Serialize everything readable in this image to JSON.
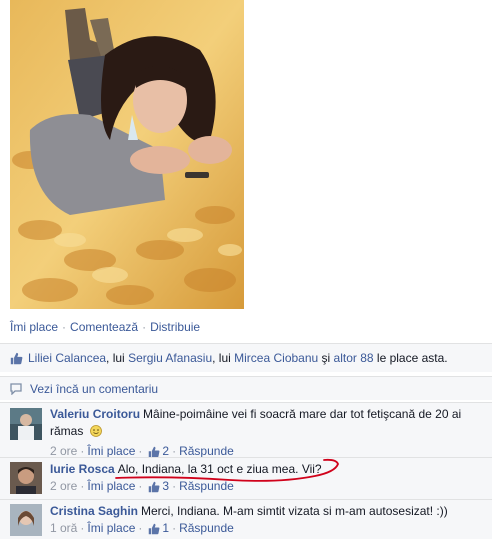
{
  "post_actions": {
    "like": "Îmi place",
    "comment": "Comentează",
    "share": "Distribuie",
    "separator": "·"
  },
  "likes": {
    "name1": "Liliei Calancea",
    "sep1": ", lui ",
    "name2": "Sergiu Afanasiu",
    "sep2": ", lui ",
    "name3": "Mircea Ciobanu",
    "sep3": " şi ",
    "others": "altor 88",
    "tail": " le place asta."
  },
  "more_comments": {
    "label": "Vezi încă un comentariu"
  },
  "comments": [
    {
      "author": "Valeriu Croitoru",
      "text": "Mâine-poimâine vei fi soacră mare dar tot fetişcană de 20 ai rămas",
      "emoji": "smile-emoji",
      "time": "2 ore",
      "like_label": "Îmi place",
      "like_count": "2",
      "reply_label": "Răspunde"
    },
    {
      "author": "Iurie Rosca",
      "text": "Alo, Indiana, la 31 oct e ziua mea. Vii?",
      "time": "2 ore",
      "like_label": "Îmi place",
      "like_count": "3",
      "reply_label": "Răspunde"
    },
    {
      "author": "Cristina Saghin",
      "text": "Merci, Indiana. M-am simtit vizata si m-am autosesizat! :))",
      "time": "1 oră",
      "like_label": "Îmi place",
      "like_count": "1",
      "reply_label": "Răspunde"
    }
  ],
  "colors": {
    "link": "#3b5998",
    "meta": "#9197a3",
    "panel": "#f6f7f9",
    "annotation": "#d0021b"
  }
}
